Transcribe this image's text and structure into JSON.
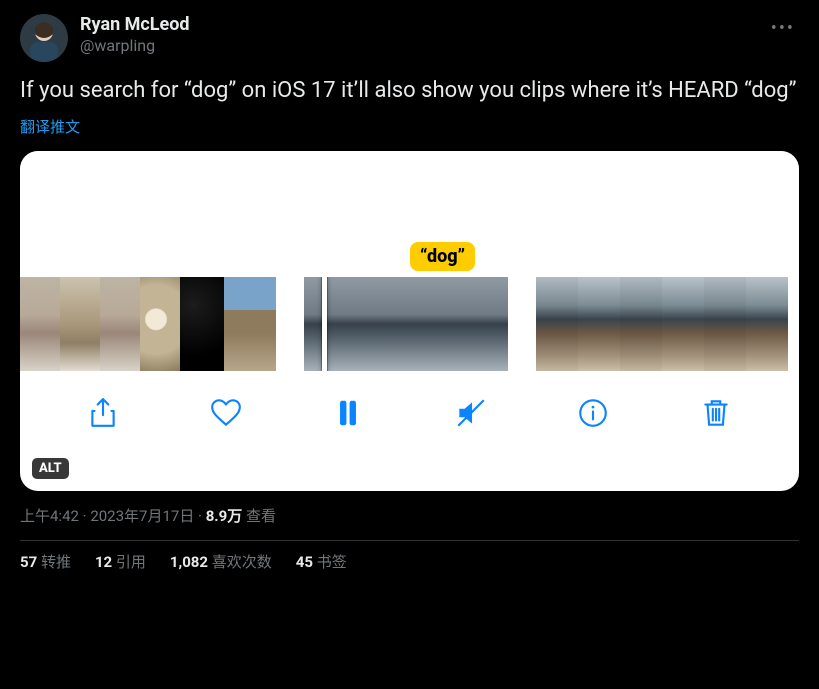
{
  "author": {
    "display_name": "Ryan McLeod",
    "handle": "@warpling"
  },
  "body": "If you search for “dog” on iOS 17 it’ll also show you clips where it’s HEARD “dog”",
  "translate_label": "翻译推文",
  "media": {
    "bubble_text": "“dog”",
    "alt_badge": "ALT",
    "icons": {
      "share": "share-icon",
      "heart": "heart-icon",
      "pause": "pause-icon",
      "mute": "mute-icon",
      "info": "info-icon",
      "trash": "trash-icon"
    }
  },
  "meta": {
    "time": "上午4:42",
    "sep": " · ",
    "date": "2023年7月17日",
    "views_count": "8.9万",
    "views_label": " 查看"
  },
  "stats": {
    "retweets": {
      "count": "57",
      "label": " 转推"
    },
    "quotes": {
      "count": "12",
      "label": " 引用"
    },
    "likes": {
      "count": "1,082",
      "label": " 喜欢次数"
    },
    "bookmarks": {
      "count": "45",
      "label": " 书签"
    }
  }
}
